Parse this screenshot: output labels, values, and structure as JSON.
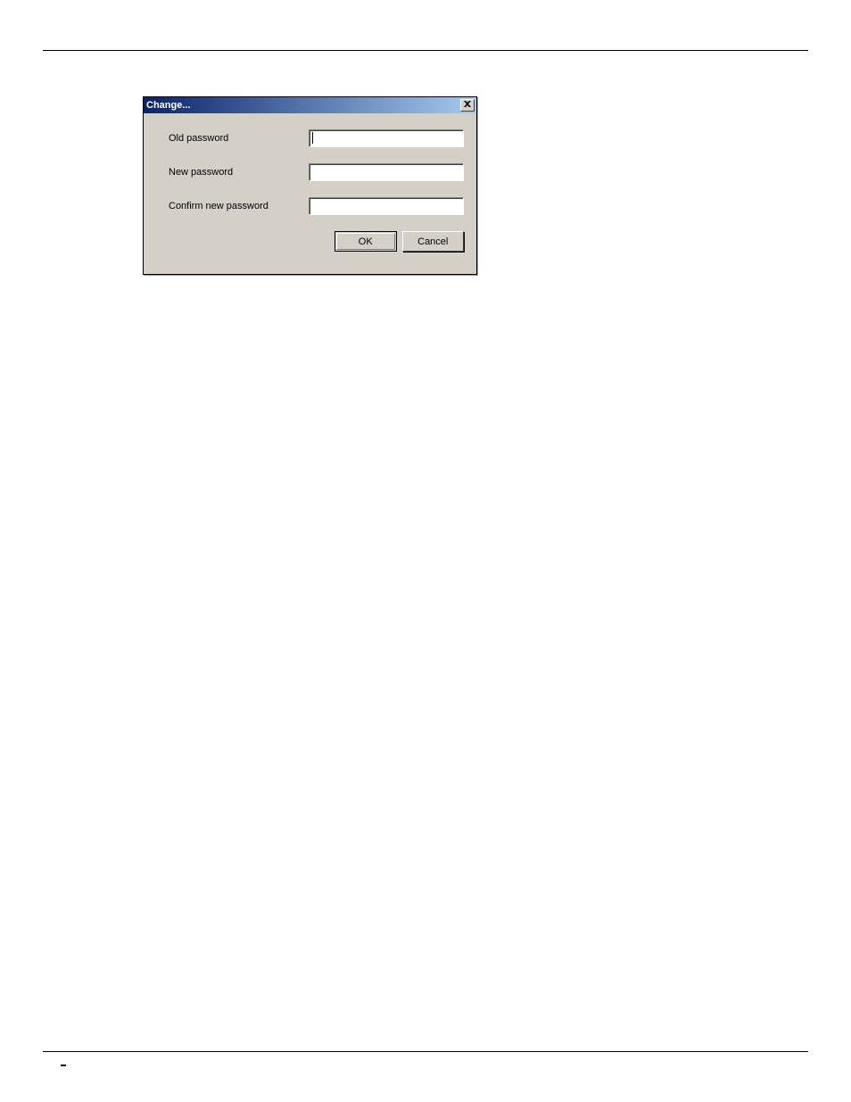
{
  "dialog": {
    "title": "Change...",
    "fields": {
      "old_password": {
        "label": "Old password",
        "value": ""
      },
      "new_password": {
        "label": "New password",
        "value": ""
      },
      "confirm_password": {
        "label": "Confirm new password",
        "value": ""
      }
    },
    "buttons": {
      "ok": "OK",
      "cancel": "Cancel"
    }
  }
}
